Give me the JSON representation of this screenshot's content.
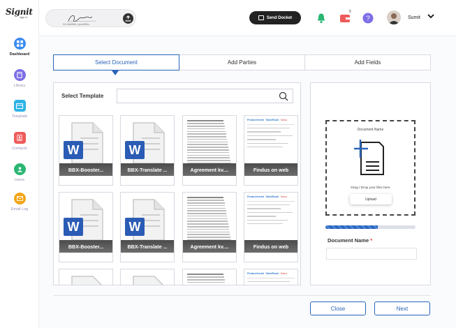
{
  "brand": {
    "logo_text": "Signit",
    "logo_sub": "sign in"
  },
  "sidebar": {
    "items": [
      {
        "label": "Dashboard",
        "icon": "grid-icon",
        "color": "#3b8cf0",
        "active": true
      },
      {
        "label": "Library",
        "icon": "book-icon",
        "color": "#7c6fe6"
      },
      {
        "label": "Template",
        "icon": "template-icon",
        "color": "#2fb3e6"
      },
      {
        "label": "Contacts",
        "icon": "contacts-icon",
        "color": "#ef5b5b"
      },
      {
        "label": "Users",
        "icon": "users-icon",
        "color": "#2bb673"
      },
      {
        "label": "Email Log",
        "icon": "mail-icon",
        "color": "#f2a516"
      }
    ]
  },
  "topbar": {
    "signature_id": "D0-9bdfH6b-1ywd4f0fa...",
    "send_docket_label": "Send Docket",
    "user_name": "Sumit",
    "notification_badge": "5"
  },
  "tabs": [
    {
      "label": "Select Document",
      "active": true
    },
    {
      "label": "Add Parties"
    },
    {
      "label": "Add Fields"
    }
  ],
  "template_panel": {
    "label": "Select Template",
    "search_placeholder": "",
    "cards": [
      {
        "kind": "word",
        "label": "BBX-Booster..."
      },
      {
        "kind": "word",
        "label": "BBX-Translate ..."
      },
      {
        "kind": "text",
        "label": "Agreement kv...."
      },
      {
        "kind": "findus",
        "label": "Findus on web"
      },
      {
        "kind": "word",
        "label": "BBX-Booster..."
      },
      {
        "kind": "word",
        "label": "BBX-Translate ..."
      },
      {
        "kind": "text",
        "label": "Agreement kv...."
      },
      {
        "kind": "findus",
        "label": "Findus on web"
      },
      {
        "kind": "blank",
        "label": ""
      },
      {
        "kind": "blank",
        "label": ""
      },
      {
        "kind": "text",
        "label": ""
      },
      {
        "kind": "findus",
        "label": ""
      }
    ],
    "findus_brands": [
      "FindusVerdet",
      "TableRush",
      "Salsa"
    ]
  },
  "upload_panel": {
    "title": "Document Name",
    "hint": "Drag / Drop your files here",
    "upload_label": "Upload",
    "progress_fraction": 0.58,
    "doc_name_label": "Document Name",
    "required_mark": "*",
    "doc_name_value": ""
  },
  "footer": {
    "close_label": "Close",
    "next_label": "Next"
  }
}
